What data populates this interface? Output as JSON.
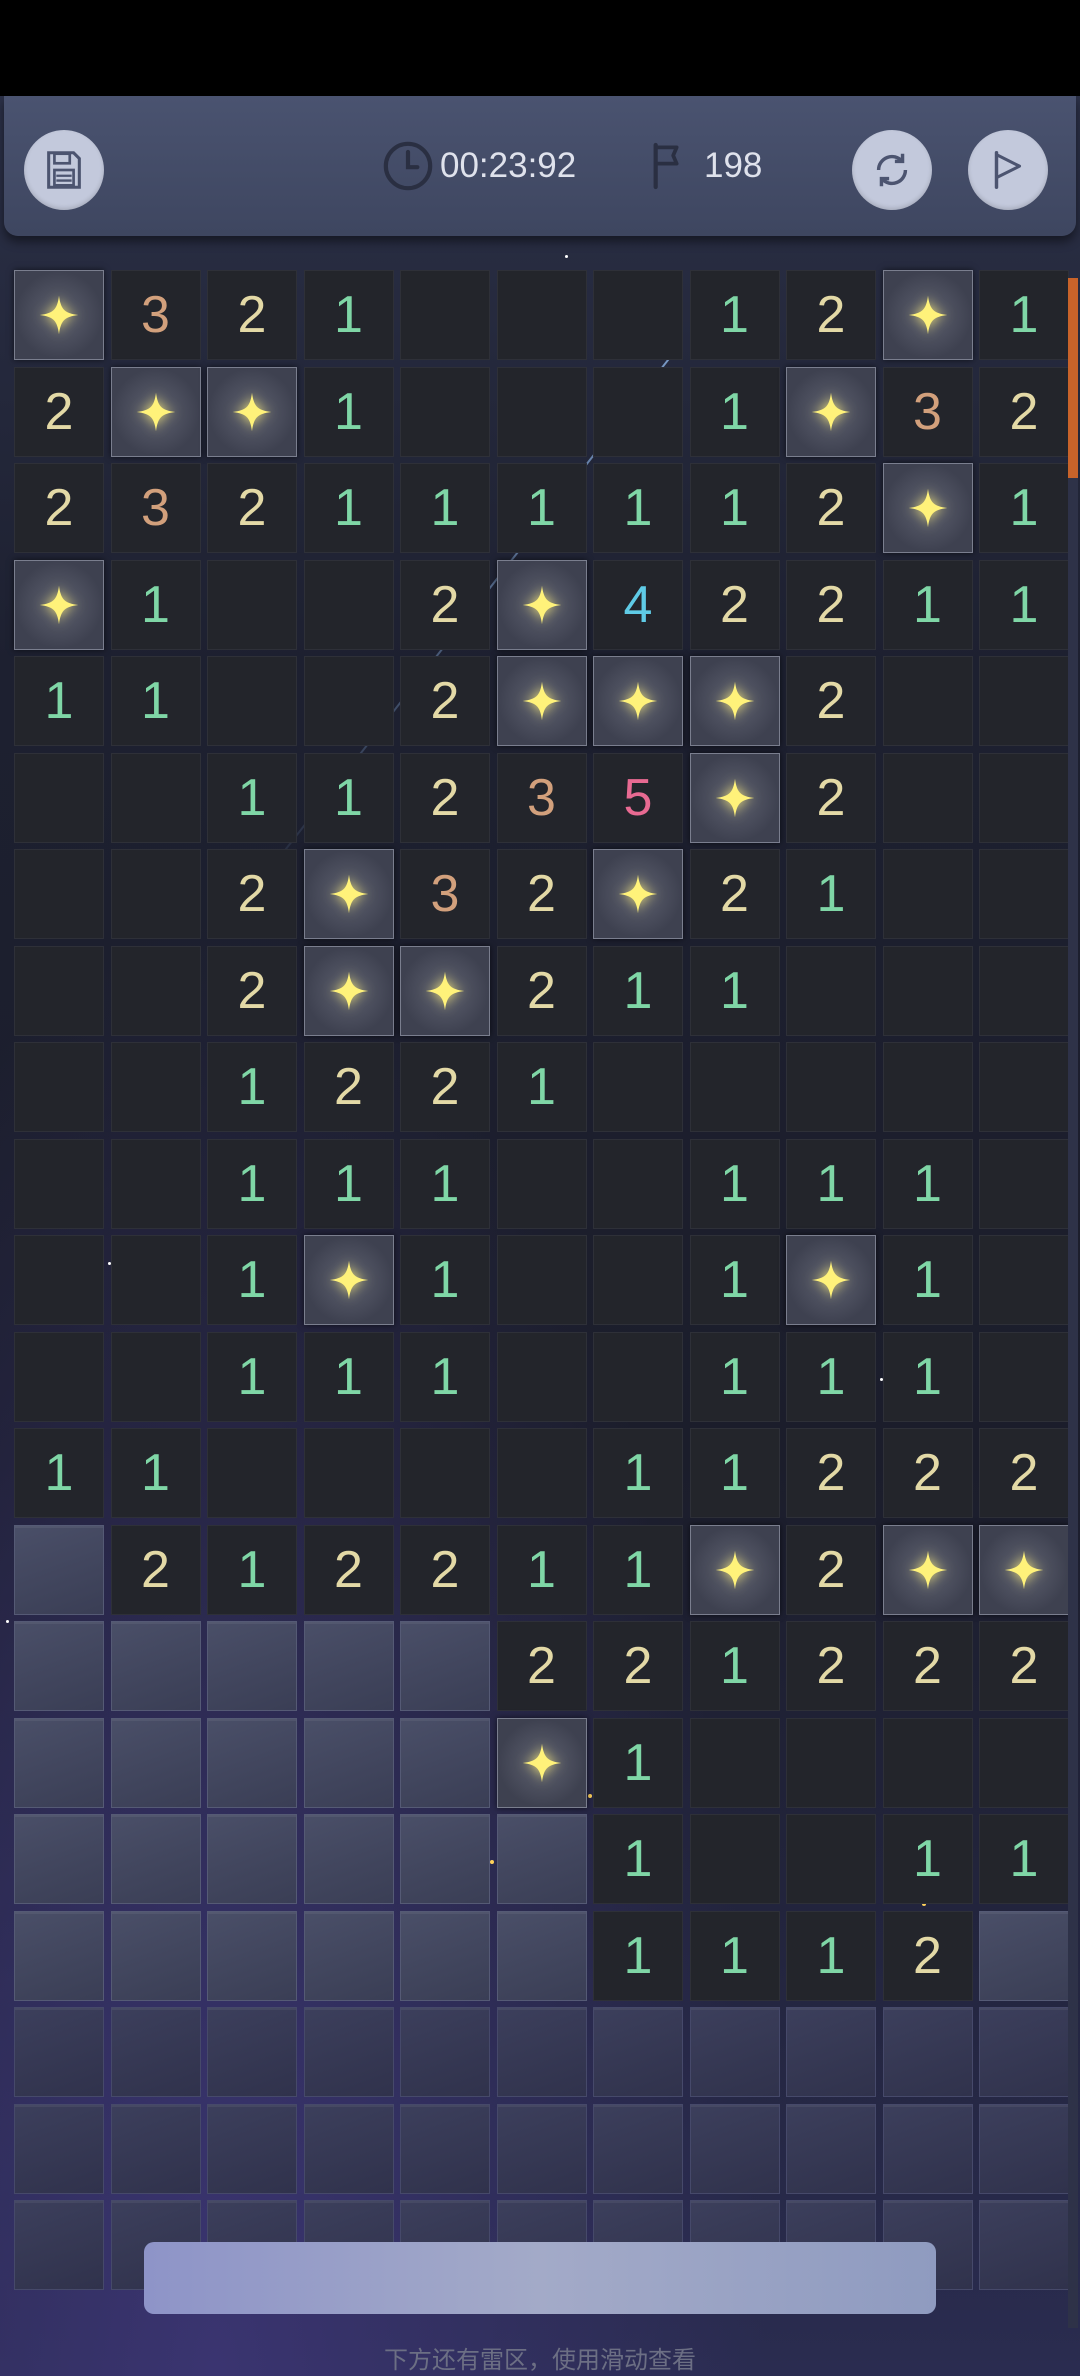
{
  "toolbar": {
    "timer": "00:23:92",
    "flags": "198"
  },
  "footer": {
    "hint": "下方还有雷区，使用滑动查看"
  },
  "colors": {
    "1": "#7fd6a6",
    "2": "#e3d9a6",
    "3": "#d2a07c",
    "4": "#5fcbe6",
    "5": "#e86a92",
    "star": "#fff27a"
  },
  "board": {
    "rows": [
      [
        "M",
        "3",
        "2",
        "1",
        "_",
        "_",
        "_",
        "1",
        "2",
        "M",
        "1"
      ],
      [
        "2",
        "M",
        "M",
        "1",
        "_",
        "_",
        "_",
        "1",
        "M",
        "3",
        "2"
      ],
      [
        "2",
        "3",
        "2",
        "1",
        "1",
        "1",
        "1",
        "1",
        "2",
        "M",
        "1"
      ],
      [
        "M",
        "1",
        "_",
        "_",
        "2",
        "M",
        "4",
        "2",
        "2",
        "1",
        "1"
      ],
      [
        "1",
        "1",
        "_",
        "_",
        "2",
        "M",
        "M",
        "M",
        "2",
        "_",
        "_"
      ],
      [
        "_",
        "_",
        "1",
        "1",
        "2",
        "3",
        "5",
        "M",
        "2",
        "_",
        "_"
      ],
      [
        "_",
        "_",
        "2",
        "M",
        "3",
        "2",
        "M",
        "2",
        "1",
        "_",
        "_"
      ],
      [
        "_",
        "_",
        "2",
        "M",
        "M",
        "2",
        "1",
        "1",
        "_",
        "_",
        "_"
      ],
      [
        "_",
        "_",
        "1",
        "2",
        "2",
        "1",
        "_",
        "_",
        "_",
        "_",
        "_"
      ],
      [
        "_",
        "_",
        "1",
        "1",
        "1",
        "_",
        "_",
        "1",
        "1",
        "1",
        "_"
      ],
      [
        "_",
        "_",
        "1",
        "M",
        "1",
        "_",
        "_",
        "1",
        "M",
        "1",
        "_"
      ],
      [
        "_",
        "_",
        "1",
        "1",
        "1",
        "_",
        "_",
        "1",
        "1",
        "1",
        "_"
      ],
      [
        "1",
        "1",
        "_",
        "_",
        "_",
        "_",
        "1",
        "1",
        "2",
        "2",
        "2"
      ],
      [
        "C",
        "2",
        "1",
        "2",
        "2",
        "1",
        "1",
        "M",
        "2",
        "M",
        "M"
      ],
      [
        "C",
        "C",
        "C",
        "C",
        "C",
        "2",
        "2",
        "1",
        "2",
        "2",
        "2"
      ],
      [
        "C",
        "C",
        "C",
        "C",
        "C",
        "M",
        "1",
        "_",
        "_",
        "_",
        "_"
      ],
      [
        "C",
        "C",
        "C",
        "C",
        "C",
        "C",
        "1",
        "_",
        "_",
        "1",
        "1"
      ],
      [
        "C",
        "C",
        "C",
        "C",
        "C",
        "C",
        "1",
        "1",
        "1",
        "2",
        "C"
      ],
      [
        "C",
        "C",
        "C",
        "C",
        "C",
        "C",
        "C",
        "C",
        "C",
        "C",
        "C"
      ],
      [
        "C",
        "C",
        "C",
        "C",
        "C",
        "C",
        "C",
        "C",
        "C",
        "C",
        "C"
      ],
      [
        "C",
        "C",
        "C",
        "C",
        "C",
        "C",
        "C",
        "C",
        "C",
        "C",
        "C"
      ]
    ]
  }
}
